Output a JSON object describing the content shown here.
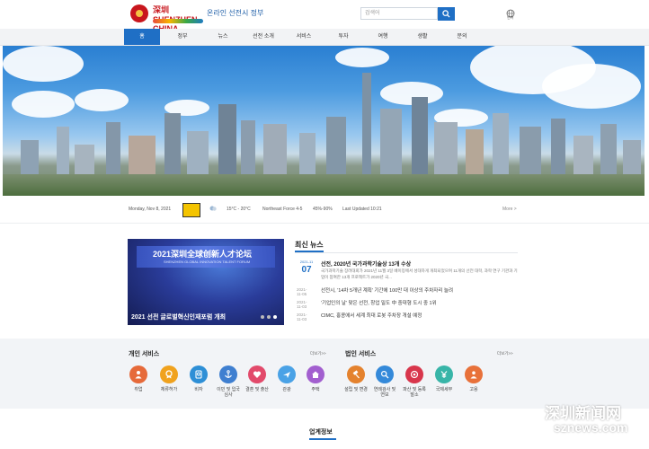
{
  "header": {
    "logo_text": "深圳 SHENZHEN CHINA",
    "site_title": "온라인 선전시 정부",
    "search_placeholder": "검색어",
    "language_label": "언어"
  },
  "nav": {
    "items": [
      "홈",
      "정부",
      "뉴스",
      "선전 소개",
      "서비스",
      "투자",
      "여행",
      "생활",
      "문의"
    ],
    "active_index": 0
  },
  "weather": {
    "date": "Monday, Nov 8, 2021",
    "temperature": "15°C - 20°C",
    "wind": "Northeast Force 4-5",
    "humidity": "45%-90%",
    "last_updated": "Last Updated 10:21",
    "more": "More >"
  },
  "featured_news": {
    "image_title": "2021深圳全球创新人才论坛",
    "image_subtitle": "SHENZHEN GLOBAL INNOVATION TALENT FORUM",
    "caption": "2021 선전 글로벌혁신인재포럼 개최"
  },
  "latest_news": {
    "title": "최신 뉴스",
    "featured": {
      "year_month": "2021-11",
      "day": "07",
      "headline": "선전, 2020년 국가과학기술상 13개 수상",
      "summary": "국가과학기술 장려대회가 2021년 11월 3일 베이징에서 성대하게 개최되었으며 11개의 선전 대학, 과학 연구 기관과 기업이 참여한 13개 프로젝트가 2020년 국..."
    },
    "items": [
      {
        "date": "2021-11-05",
        "title": "선전시, '14차 5개년 계획' 기간에 100만 대 이상의 주차자리 늘려"
      },
      {
        "date": "2021-11-03",
        "title": "'기업인의 날' 맞은 선전, 창업 밀도 中 중대형 도시 중 1위"
      },
      {
        "date": "2021-11-03",
        "title": "CIMC, 홍콩에서 세계 최대 로봇 주차장 개설 예정"
      }
    ]
  },
  "services": {
    "personal": {
      "title": "개인 서비스",
      "more": "더보기>>",
      "items": [
        "취업",
        "체류허가",
        "비자",
        "이민 및 입국심사",
        "결혼 및 출산",
        "관광",
        "주택"
      ]
    },
    "corporate": {
      "title": "법인 서비스",
      "more": "더보기>>",
      "items": [
        "설립 및 변경",
        "연례검사 및 연보",
        "파산 및 등록말소",
        "국제세무",
        "고용"
      ]
    }
  },
  "industry": {
    "title": "업계정보"
  },
  "watermark": {
    "zh": "深圳新闻网",
    "en": "sznews.com"
  },
  "colors": {
    "accent": "#1f6fc5",
    "nav_bg": "#f2f3f5",
    "services_bg": "#f2f4f7"
  }
}
